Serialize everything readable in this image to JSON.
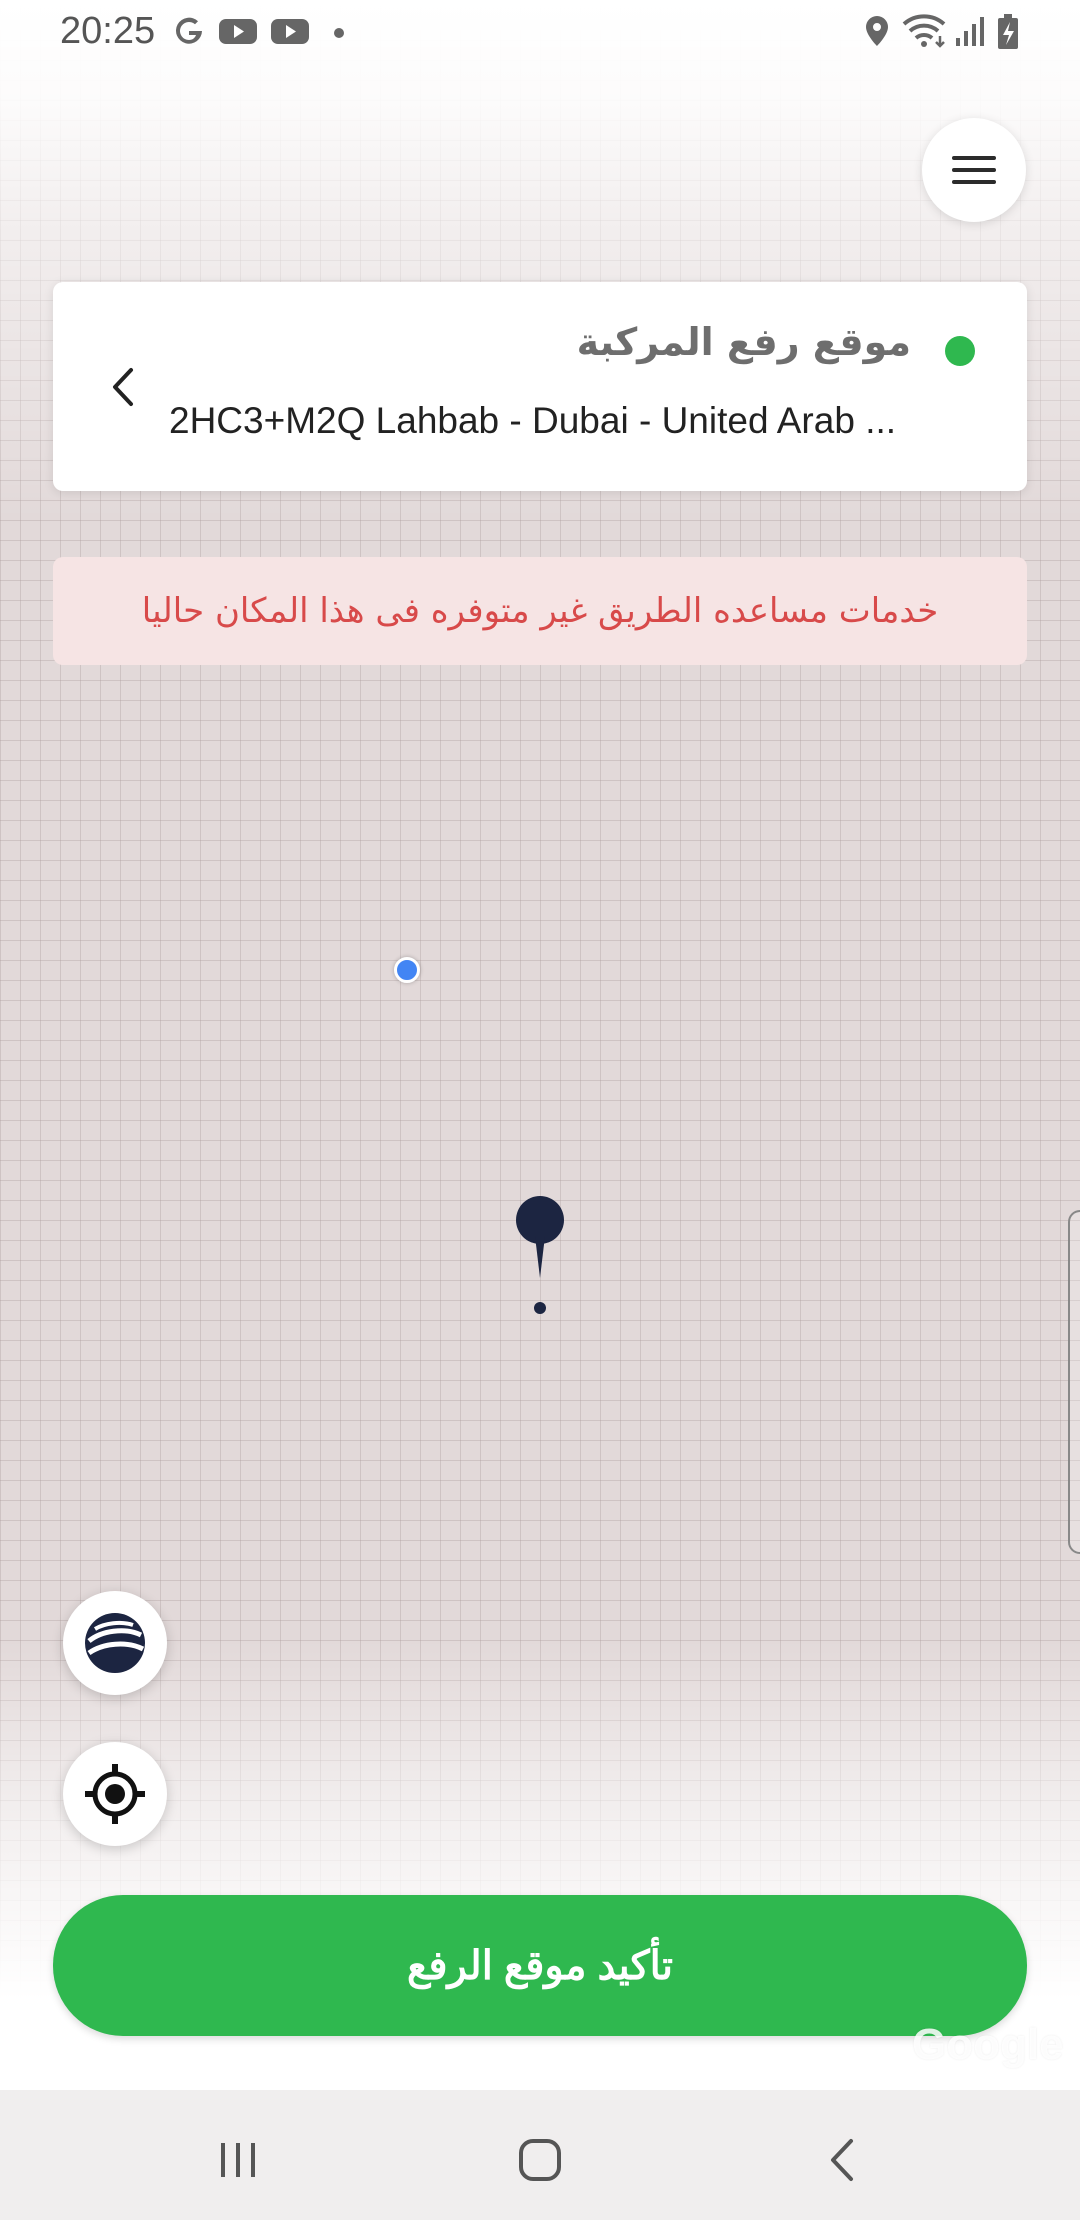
{
  "status_bar": {
    "time": "20:25",
    "left_icons": [
      "google-icon",
      "youtube-icon",
      "youtube-icon",
      "dot-icon"
    ],
    "right_icons": [
      "location-icon",
      "wifi-icon",
      "signal-icon",
      "battery-charging-icon"
    ]
  },
  "menu": {
    "icon": "hamburger-menu-icon"
  },
  "pickup_card": {
    "title": "موقع رفع المركبة",
    "address": "2HC3+M2Q Lahbab - Dubai - United Arab ...",
    "status_color": "#2fb84f",
    "back_icon": "chevron-left-icon"
  },
  "alert": {
    "message": "خدمات مساعده الطريق غير متوفره فى هذا المكان حاليا",
    "text_color": "#d84a4a",
    "background_color": "#f6e4e4"
  },
  "map": {
    "current_location_color": "#4285f4",
    "pin_color": "#1c2541",
    "watermark": "Google"
  },
  "map_controls": {
    "layers_icon": "globe-layers-icon",
    "locate_icon": "crosshair-locate-icon"
  },
  "confirm_button": {
    "label": "تأكيد موقع الرفع",
    "color": "#2fb84f"
  },
  "nav_bar": {
    "recents_icon": "recents-icon",
    "home_icon": "home-icon",
    "back_icon": "back-icon"
  }
}
